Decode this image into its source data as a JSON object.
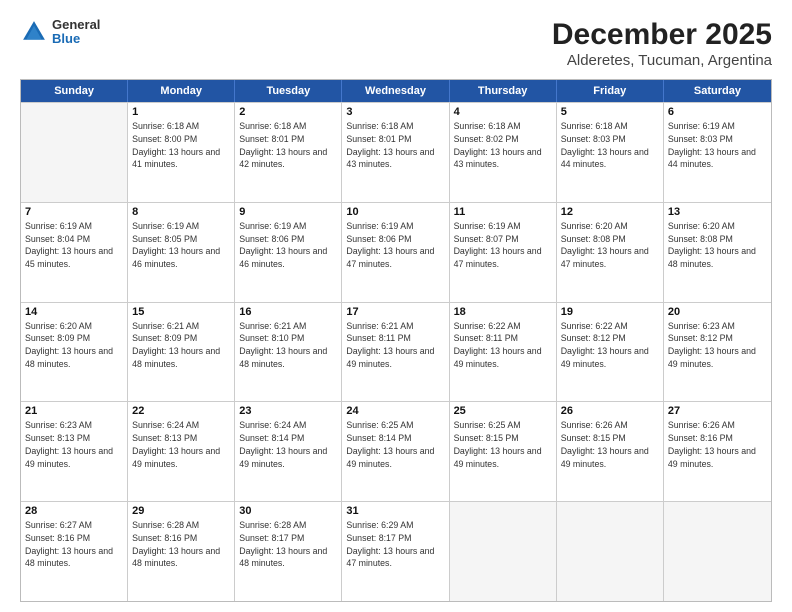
{
  "logo": {
    "general": "General",
    "blue": "Blue"
  },
  "header": {
    "title": "December 2025",
    "subtitle": "Alderetes, Tucuman, Argentina"
  },
  "days_of_week": [
    "Sunday",
    "Monday",
    "Tuesday",
    "Wednesday",
    "Thursday",
    "Friday",
    "Saturday"
  ],
  "weeks": [
    [
      {
        "day": "",
        "empty": true
      },
      {
        "day": "1",
        "sunrise": "Sunrise: 6:18 AM",
        "sunset": "Sunset: 8:00 PM",
        "daylight": "Daylight: 13 hours and 41 minutes."
      },
      {
        "day": "2",
        "sunrise": "Sunrise: 6:18 AM",
        "sunset": "Sunset: 8:01 PM",
        "daylight": "Daylight: 13 hours and 42 minutes."
      },
      {
        "day": "3",
        "sunrise": "Sunrise: 6:18 AM",
        "sunset": "Sunset: 8:01 PM",
        "daylight": "Daylight: 13 hours and 43 minutes."
      },
      {
        "day": "4",
        "sunrise": "Sunrise: 6:18 AM",
        "sunset": "Sunset: 8:02 PM",
        "daylight": "Daylight: 13 hours and 43 minutes."
      },
      {
        "day": "5",
        "sunrise": "Sunrise: 6:18 AM",
        "sunset": "Sunset: 8:03 PM",
        "daylight": "Daylight: 13 hours and 44 minutes."
      },
      {
        "day": "6",
        "sunrise": "Sunrise: 6:19 AM",
        "sunset": "Sunset: 8:03 PM",
        "daylight": "Daylight: 13 hours and 44 minutes."
      }
    ],
    [
      {
        "day": "7",
        "sunrise": "Sunrise: 6:19 AM",
        "sunset": "Sunset: 8:04 PM",
        "daylight": "Daylight: 13 hours and 45 minutes."
      },
      {
        "day": "8",
        "sunrise": "Sunrise: 6:19 AM",
        "sunset": "Sunset: 8:05 PM",
        "daylight": "Daylight: 13 hours and 46 minutes."
      },
      {
        "day": "9",
        "sunrise": "Sunrise: 6:19 AM",
        "sunset": "Sunset: 8:06 PM",
        "daylight": "Daylight: 13 hours and 46 minutes."
      },
      {
        "day": "10",
        "sunrise": "Sunrise: 6:19 AM",
        "sunset": "Sunset: 8:06 PM",
        "daylight": "Daylight: 13 hours and 47 minutes."
      },
      {
        "day": "11",
        "sunrise": "Sunrise: 6:19 AM",
        "sunset": "Sunset: 8:07 PM",
        "daylight": "Daylight: 13 hours and 47 minutes."
      },
      {
        "day": "12",
        "sunrise": "Sunrise: 6:20 AM",
        "sunset": "Sunset: 8:08 PM",
        "daylight": "Daylight: 13 hours and 47 minutes."
      },
      {
        "day": "13",
        "sunrise": "Sunrise: 6:20 AM",
        "sunset": "Sunset: 8:08 PM",
        "daylight": "Daylight: 13 hours and 48 minutes."
      }
    ],
    [
      {
        "day": "14",
        "sunrise": "Sunrise: 6:20 AM",
        "sunset": "Sunset: 8:09 PM",
        "daylight": "Daylight: 13 hours and 48 minutes."
      },
      {
        "day": "15",
        "sunrise": "Sunrise: 6:21 AM",
        "sunset": "Sunset: 8:09 PM",
        "daylight": "Daylight: 13 hours and 48 minutes."
      },
      {
        "day": "16",
        "sunrise": "Sunrise: 6:21 AM",
        "sunset": "Sunset: 8:10 PM",
        "daylight": "Daylight: 13 hours and 48 minutes."
      },
      {
        "day": "17",
        "sunrise": "Sunrise: 6:21 AM",
        "sunset": "Sunset: 8:11 PM",
        "daylight": "Daylight: 13 hours and 49 minutes."
      },
      {
        "day": "18",
        "sunrise": "Sunrise: 6:22 AM",
        "sunset": "Sunset: 8:11 PM",
        "daylight": "Daylight: 13 hours and 49 minutes."
      },
      {
        "day": "19",
        "sunrise": "Sunrise: 6:22 AM",
        "sunset": "Sunset: 8:12 PM",
        "daylight": "Daylight: 13 hours and 49 minutes."
      },
      {
        "day": "20",
        "sunrise": "Sunrise: 6:23 AM",
        "sunset": "Sunset: 8:12 PM",
        "daylight": "Daylight: 13 hours and 49 minutes."
      }
    ],
    [
      {
        "day": "21",
        "sunrise": "Sunrise: 6:23 AM",
        "sunset": "Sunset: 8:13 PM",
        "daylight": "Daylight: 13 hours and 49 minutes."
      },
      {
        "day": "22",
        "sunrise": "Sunrise: 6:24 AM",
        "sunset": "Sunset: 8:13 PM",
        "daylight": "Daylight: 13 hours and 49 minutes."
      },
      {
        "day": "23",
        "sunrise": "Sunrise: 6:24 AM",
        "sunset": "Sunset: 8:14 PM",
        "daylight": "Daylight: 13 hours and 49 minutes."
      },
      {
        "day": "24",
        "sunrise": "Sunrise: 6:25 AM",
        "sunset": "Sunset: 8:14 PM",
        "daylight": "Daylight: 13 hours and 49 minutes."
      },
      {
        "day": "25",
        "sunrise": "Sunrise: 6:25 AM",
        "sunset": "Sunset: 8:15 PM",
        "daylight": "Daylight: 13 hours and 49 minutes."
      },
      {
        "day": "26",
        "sunrise": "Sunrise: 6:26 AM",
        "sunset": "Sunset: 8:15 PM",
        "daylight": "Daylight: 13 hours and 49 minutes."
      },
      {
        "day": "27",
        "sunrise": "Sunrise: 6:26 AM",
        "sunset": "Sunset: 8:16 PM",
        "daylight": "Daylight: 13 hours and 49 minutes."
      }
    ],
    [
      {
        "day": "28",
        "sunrise": "Sunrise: 6:27 AM",
        "sunset": "Sunset: 8:16 PM",
        "daylight": "Daylight: 13 hours and 48 minutes."
      },
      {
        "day": "29",
        "sunrise": "Sunrise: 6:28 AM",
        "sunset": "Sunset: 8:16 PM",
        "daylight": "Daylight: 13 hours and 48 minutes."
      },
      {
        "day": "30",
        "sunrise": "Sunrise: 6:28 AM",
        "sunset": "Sunset: 8:17 PM",
        "daylight": "Daylight: 13 hours and 48 minutes."
      },
      {
        "day": "31",
        "sunrise": "Sunrise: 6:29 AM",
        "sunset": "Sunset: 8:17 PM",
        "daylight": "Daylight: 13 hours and 47 minutes."
      },
      {
        "day": "",
        "empty": true
      },
      {
        "day": "",
        "empty": true
      },
      {
        "day": "",
        "empty": true
      }
    ]
  ]
}
